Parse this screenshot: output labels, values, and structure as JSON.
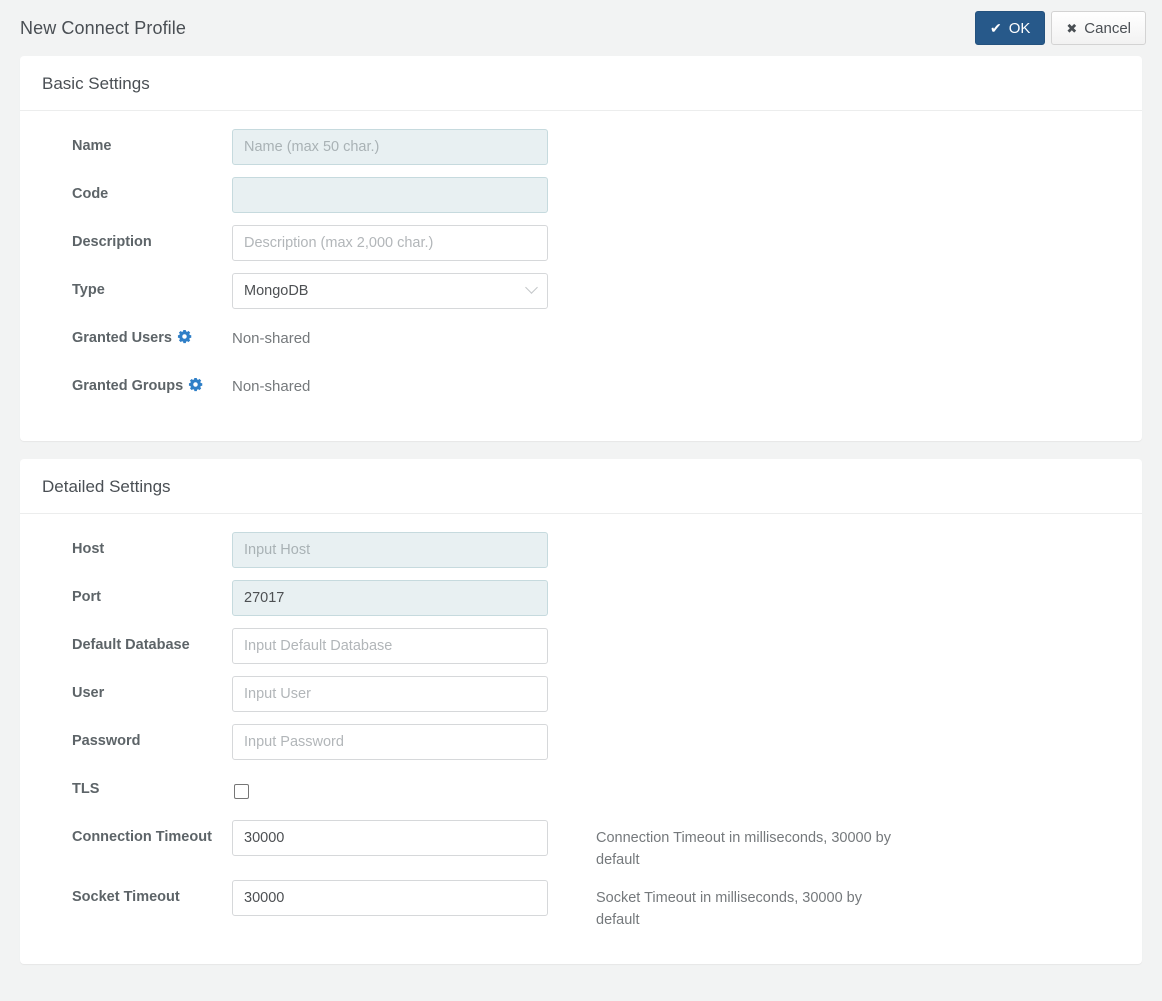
{
  "header": {
    "title": "New Connect Profile",
    "ok_label": "OK",
    "ok_icon": "check-icon",
    "cancel_label": "Cancel",
    "cancel_icon": "cross-icon",
    "ok_color": "#27598a"
  },
  "basic_settings": {
    "title": "Basic Settings",
    "fields": {
      "name": {
        "label": "Name",
        "value": "",
        "placeholder": "Name (max 50 char.)"
      },
      "code": {
        "label": "Code",
        "value": "",
        "placeholder": ""
      },
      "description": {
        "label": "Description",
        "value": "",
        "placeholder": "Description (max 2,000 char.)"
      },
      "type": {
        "label": "Type",
        "value": "MongoDB",
        "options": [
          "MongoDB"
        ]
      },
      "granted_users": {
        "label": "Granted Users",
        "icon": "gear-icon",
        "value": "Non-shared"
      },
      "granted_groups": {
        "label": "Granted Groups",
        "icon": "gear-icon",
        "value": "Non-shared"
      }
    }
  },
  "detailed_settings": {
    "title": "Detailed Settings",
    "fields": {
      "host": {
        "label": "Host",
        "value": "",
        "placeholder": "Input Host"
      },
      "port": {
        "label": "Port",
        "value": "27017",
        "placeholder": ""
      },
      "default_database": {
        "label": "Default Database",
        "value": "",
        "placeholder": "Input Default Database"
      },
      "user": {
        "label": "User",
        "value": "",
        "placeholder": "Input User"
      },
      "password": {
        "label": "Password",
        "value": "",
        "placeholder": "Input Password"
      },
      "tls": {
        "label": "TLS",
        "checked": false
      },
      "connection_timeout": {
        "label": "Connection Timeout",
        "value": "30000",
        "help": "Connection Timeout in milliseconds, 30000 by default"
      },
      "socket_timeout": {
        "label": "Socket Timeout",
        "value": "30000",
        "help": "Socket Timeout in milliseconds, 30000 by default"
      }
    }
  }
}
